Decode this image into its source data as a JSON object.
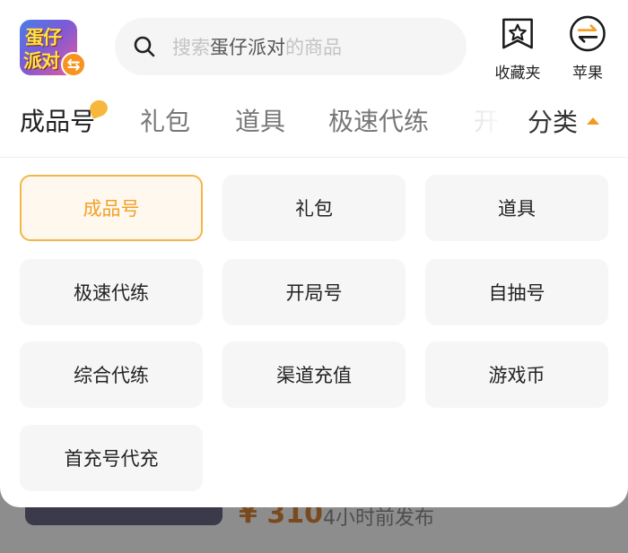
{
  "app": {
    "logo_line1": "蛋仔",
    "logo_line2": "派对",
    "logo_badge": "⇆"
  },
  "search": {
    "placeholder_prefix": "搜索",
    "placeholder_game": "蛋仔派对",
    "placeholder_suffix": "的商品"
  },
  "header": {
    "favorites_label": "收藏夹",
    "platform_label": "苹果"
  },
  "tabs": [
    {
      "label": "成品号",
      "active": true
    },
    {
      "label": "礼包",
      "active": false
    },
    {
      "label": "道具",
      "active": false
    },
    {
      "label": "极速代练",
      "active": false
    },
    {
      "label": "开",
      "active": false
    }
  ],
  "category_toggle": {
    "label": "分类"
  },
  "categories": [
    {
      "label": "成品号",
      "selected": true
    },
    {
      "label": "礼包",
      "selected": false
    },
    {
      "label": "道具",
      "selected": false
    },
    {
      "label": "极速代练",
      "selected": false
    },
    {
      "label": "开局号",
      "selected": false
    },
    {
      "label": "自抽号",
      "selected": false
    },
    {
      "label": "综合代练",
      "selected": false
    },
    {
      "label": "渠道充值",
      "selected": false
    },
    {
      "label": "游戏币",
      "selected": false
    },
    {
      "label": "首充号代充",
      "selected": false
    }
  ],
  "background_listing": {
    "price": "¥ 310",
    "time": "4小时前发布"
  },
  "colors": {
    "accent": "#f3a02a",
    "accent_border": "#f3b548",
    "selected_bg": "#fff8ee",
    "tile_bg": "#f6f6f6"
  }
}
